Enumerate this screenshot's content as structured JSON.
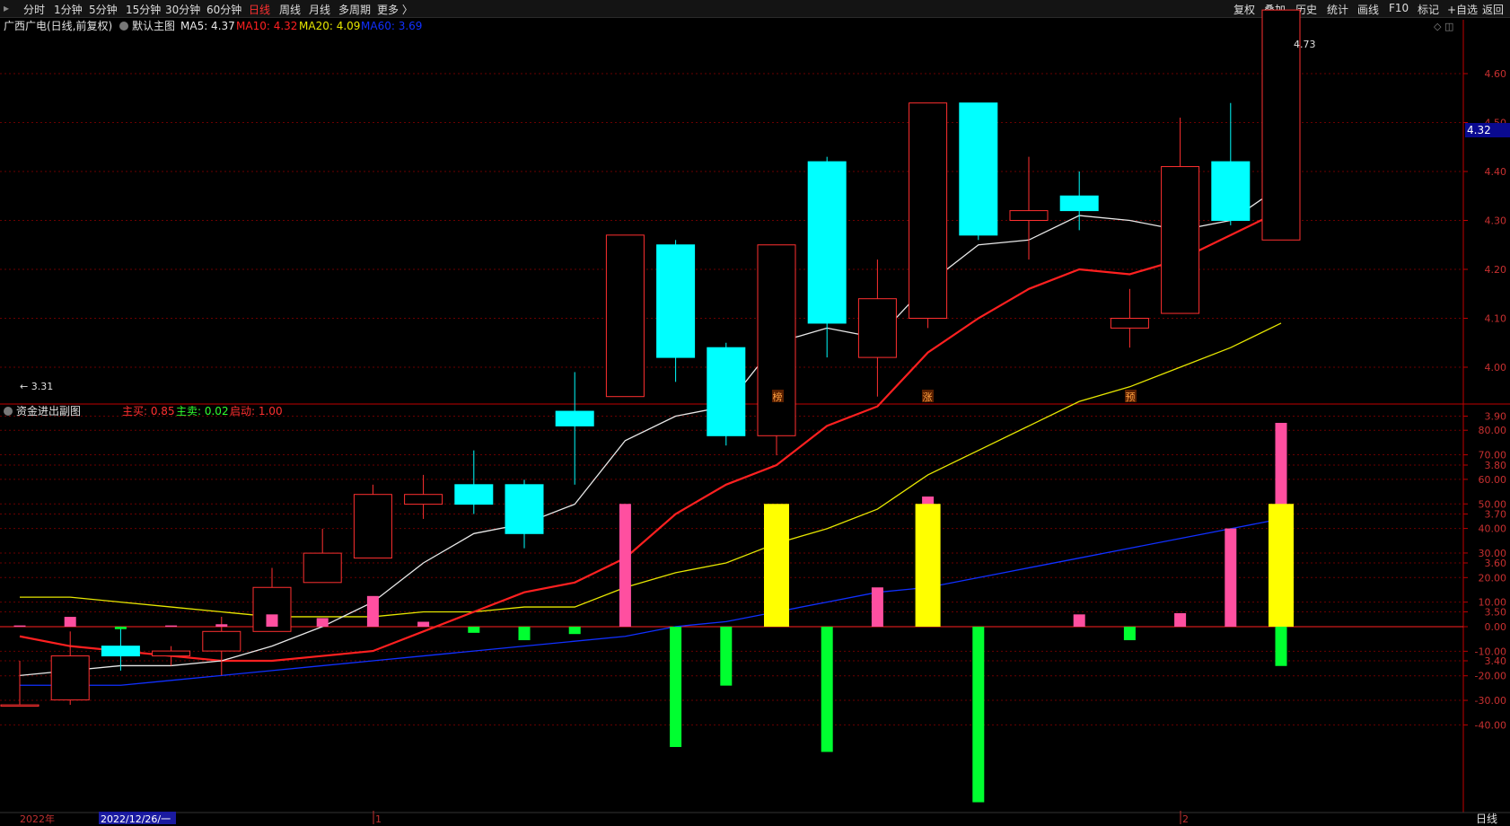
{
  "toolbar": {
    "left_items": [
      "分时",
      "1分钟",
      "5分钟",
      "15分钟",
      "30分钟",
      "60分钟",
      "日线",
      "周线",
      "月线",
      "多周期",
      "更多 〉"
    ],
    "active_item": "日线",
    "right_items": [
      "复权",
      "叠加",
      "历史",
      "统计",
      "画线",
      "F10",
      "标记",
      "+自选",
      "返回"
    ]
  },
  "main_panel": {
    "title": "广西广电(日线,前复权)",
    "template_label": "默认主图",
    "ma_legend": [
      {
        "label": "MA5: 4.37",
        "color": "#e8e8e8"
      },
      {
        "label": "MA10: 4.32",
        "color": "#ff2020"
      },
      {
        "label": "MA20: 4.09",
        "color": "#e6e600"
      },
      {
        "label": "MA60: 3.69",
        "color": "#1030ff"
      }
    ],
    "current_price_tag": "4.32",
    "high_annotation": "4.73",
    "low_annotation": "3.31",
    "event_markers": [
      "榜",
      "涨",
      "预"
    ]
  },
  "sub_panel": {
    "title": "资金进出副图",
    "legend": [
      {
        "label": "主买: 0.85",
        "color": "#ff3030"
      },
      {
        "label": "主卖: 0.02",
        "color": "#30ff30"
      },
      {
        "label": "启动: 1.00",
        "color": "#ff3030"
      }
    ]
  },
  "bottom_bar": {
    "year_label": "2022年",
    "cursor_date": "2022/12/26/一",
    "month_ticks": [
      "1",
      "2"
    ],
    "period_label": "日线"
  },
  "colors": {
    "up": "#ff3030",
    "down": "#00ffff",
    "grid": "#6a0000",
    "axis": "#c00000",
    "bg": "#000000",
    "ma5": "#e8e8e8",
    "ma10": "#ff2020",
    "ma20": "#e6e600",
    "ma60": "#1030ff",
    "buy": "#ff4fa0",
    "sell": "#00ff30",
    "start": "#ffff00"
  },
  "chart_data": [
    {
      "type": "candlestick",
      "title": "广西广电(日线,前复权)",
      "y_ticks": [
        3.4,
        3.5,
        3.6,
        3.7,
        3.8,
        3.9,
        4.0,
        4.1,
        4.2,
        4.3,
        4.4,
        4.5,
        4.6
      ],
      "ylim": [
        3.28,
        4.8
      ],
      "candles": [
        {
          "o": 3.31,
          "h": 3.4,
          "l": 3.31,
          "c": 3.31
        },
        {
          "o": 3.32,
          "h": 3.46,
          "l": 3.31,
          "c": 3.41
        },
        {
          "o": 3.43,
          "h": 3.47,
          "l": 3.38,
          "c": 3.41
        },
        {
          "o": 3.41,
          "h": 3.43,
          "l": 3.39,
          "c": 3.42
        },
        {
          "o": 3.42,
          "h": 3.49,
          "l": 3.37,
          "c": 3.46
        },
        {
          "o": 3.46,
          "h": 3.59,
          "l": 3.46,
          "c": 3.55
        },
        {
          "o": 3.56,
          "h": 3.67,
          "l": 3.56,
          "c": 3.62
        },
        {
          "o": 3.61,
          "h": 3.76,
          "l": 3.61,
          "c": 3.74
        },
        {
          "o": 3.72,
          "h": 3.78,
          "l": 3.69,
          "c": 3.74
        },
        {
          "o": 3.76,
          "h": 3.83,
          "l": 3.7,
          "c": 3.72
        },
        {
          "o": 3.76,
          "h": 3.77,
          "l": 3.63,
          "c": 3.66
        },
        {
          "o": 3.91,
          "h": 3.99,
          "l": 3.76,
          "c": 3.88
        },
        {
          "o": 3.94,
          "h": 4.27,
          "l": 3.94,
          "c": 4.27
        },
        {
          "o": 4.25,
          "h": 4.26,
          "l": 3.97,
          "c": 4.02
        },
        {
          "o": 4.04,
          "h": 4.05,
          "l": 3.84,
          "c": 3.86
        },
        {
          "o": 3.86,
          "h": 4.25,
          "l": 3.82,
          "c": 4.25
        },
        {
          "o": 4.42,
          "h": 4.43,
          "l": 4.02,
          "c": 4.09
        },
        {
          "o": 4.02,
          "h": 4.22,
          "l": 3.94,
          "c": 4.14
        },
        {
          "o": 4.1,
          "h": 4.54,
          "l": 4.08,
          "c": 4.54
        },
        {
          "o": 4.54,
          "h": 4.54,
          "l": 4.26,
          "c": 4.27
        },
        {
          "o": 4.3,
          "h": 4.43,
          "l": 4.22,
          "c": 4.32
        },
        {
          "o": 4.35,
          "h": 4.4,
          "l": 4.28,
          "c": 4.32
        },
        {
          "o": 4.08,
          "h": 4.16,
          "l": 4.04,
          "c": 4.1
        },
        {
          "o": 4.11,
          "h": 4.51,
          "l": 4.11,
          "c": 4.41
        },
        {
          "o": 4.42,
          "h": 4.54,
          "l": 4.29,
          "c": 4.3
        },
        {
          "o": 4.26,
          "h": 4.73,
          "l": 4.26,
          "c": 4.73
        }
      ],
      "ma5": [
        3.37,
        3.38,
        3.39,
        3.39,
        3.4,
        3.43,
        3.47,
        3.52,
        3.6,
        3.66,
        3.68,
        3.72,
        3.85,
        3.9,
        3.92,
        4.05,
        4.08,
        4.06,
        4.17,
        4.25,
        4.26,
        4.31,
        4.3,
        4.28,
        4.3,
        4.37
      ],
      "ma10": [
        3.45,
        3.43,
        3.42,
        3.41,
        3.4,
        3.4,
        3.41,
        3.42,
        3.46,
        3.5,
        3.54,
        3.56,
        3.61,
        3.7,
        3.76,
        3.8,
        3.88,
        3.92,
        4.03,
        4.1,
        4.16,
        4.2,
        4.19,
        4.22,
        4.27,
        4.32
      ],
      "ma20": [
        3.53,
        3.53,
        3.52,
        3.51,
        3.5,
        3.49,
        3.49,
        3.49,
        3.5,
        3.5,
        3.51,
        3.51,
        3.55,
        3.58,
        3.6,
        3.64,
        3.67,
        3.71,
        3.78,
        3.83,
        3.88,
        3.93,
        3.96,
        4.0,
        4.04,
        4.09
      ],
      "ma60": [
        3.35,
        3.35,
        3.35,
        3.36,
        3.37,
        3.38,
        3.39,
        3.4,
        3.41,
        3.42,
        3.43,
        3.44,
        3.45,
        3.47,
        3.48,
        3.5,
        3.52,
        3.54,
        3.55,
        3.57,
        3.59,
        3.61,
        3.63,
        3.65,
        3.67,
        3.69
      ]
    },
    {
      "type": "bar",
      "title": "资金进出副图",
      "y_ticks": [
        80,
        70,
        60,
        50,
        40,
        30,
        20,
        10,
        0,
        -10,
        -20,
        -30,
        -40
      ],
      "ylim": [
        -72,
        84
      ],
      "buy": [
        0.5,
        4,
        0,
        0.5,
        1,
        5,
        3.5,
        12.5,
        2,
        0,
        0,
        0,
        50,
        0,
        0,
        0,
        0,
        16,
        53,
        0,
        0,
        5,
        0,
        5.5,
        40,
        83
      ],
      "sell": [
        0,
        0,
        -1,
        0,
        0,
        0,
        0,
        0,
        0,
        -2.5,
        -5.5,
        -3,
        0,
        -49,
        -24,
        0,
        -51,
        0,
        0,
        -71.5,
        0,
        0,
        -5.5,
        0,
        0,
        -16
      ],
      "start": [
        0,
        0,
        0,
        0,
        0,
        0,
        0,
        0,
        0,
        0,
        0,
        0,
        0,
        0,
        0,
        50,
        0,
        0,
        50,
        0,
        0,
        0,
        0,
        0,
        0,
        50
      ]
    }
  ]
}
